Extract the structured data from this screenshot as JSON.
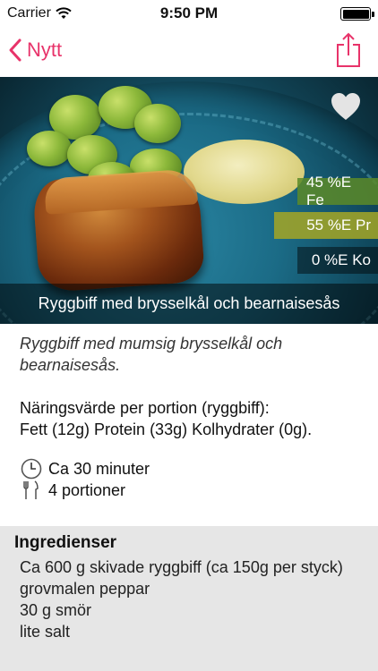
{
  "status_bar": {
    "carrier": "Carrier",
    "time": "9:50 PM",
    "icons": [
      "wifi-icon",
      "battery-icon"
    ]
  },
  "nav": {
    "back_label": "Nytt",
    "back_icon": "chevron-left-icon",
    "share_icon": "share-icon",
    "accent_color": "#e8336a"
  },
  "hero": {
    "caption": "Ryggbiff med brysselkål och bearnaisesås",
    "favorite_icon": "heart-icon",
    "macros": {
      "fat": "45 %E Fe",
      "protein": "55 %E Pr",
      "carbs": "0 %E Ko"
    }
  },
  "recipe": {
    "description": "Ryggbiff med mumsig brysselkål och bearnaisesås.",
    "nutrition_heading": "Näringsvärde per portion (ryggbiff):",
    "nutrition_values": "Fett (12g) Protein (33g) Kolhydrater (0g).",
    "time": "Ca 30 minuter",
    "servings": "4 portioner"
  },
  "ingredients": {
    "title": "Ingredienser",
    "items": [
      "Ca 600 g skivade ryggbiff (ca 150g per styck)",
      "grovmalen peppar",
      "30 g smör",
      "lite salt"
    ]
  }
}
